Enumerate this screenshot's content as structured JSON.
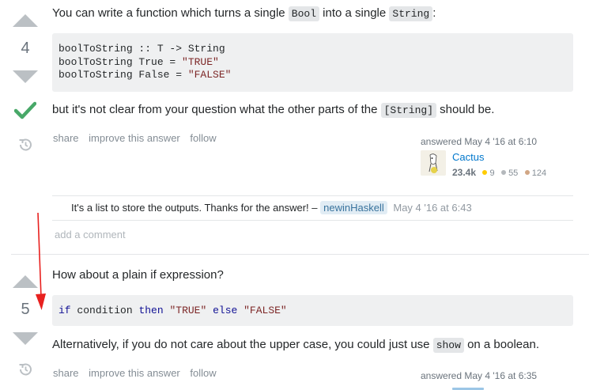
{
  "answer1": {
    "votes": "4",
    "accepted": true,
    "intro": {
      "before": "You can write a function which turns a single ",
      "code1": "Bool",
      "mid": " into a single ",
      "code2": "String",
      "after": ":"
    },
    "code_lines": [
      {
        "plain": "boolToString :: T -> String",
        "str": ""
      },
      {
        "plain": "boolToString True = ",
        "str": "\"TRUE\""
      },
      {
        "plain": "boolToString False = ",
        "str": "\"FALSE\""
      }
    ],
    "followup": {
      "before": "but it's not clear from your question what the other parts of the ",
      "code": "[String]",
      "after": " should be."
    },
    "menu": {
      "share": "share",
      "improve": "improve this answer",
      "follow": "follow"
    },
    "signature": {
      "action": "answered May 4 '16 at 6:10",
      "user": "Cactus",
      "rep": "23.4k",
      "gold": "9",
      "silver": "55",
      "bronze": "124"
    },
    "comment": {
      "text": "It's a list to store the outputs. Thanks for the answer! –",
      "user": "newinHaskell",
      "date": "May 4 '16 at 6:43"
    },
    "add_comment": "add a comment"
  },
  "answer2": {
    "votes": "5",
    "intro": "How about a plain if expression?",
    "code": {
      "kw1": "if",
      "t1": " condition ",
      "kw2": "then",
      "s1": "\"TRUE\"",
      "kw3": "else",
      "s2": "\"FALSE\""
    },
    "alt": {
      "before": "Alternatively, if you do not care about the upper case, you could just use ",
      "code": "show",
      "after": " on a boolean."
    },
    "menu": {
      "share": "share",
      "improve": "improve this answer",
      "follow": "follow"
    },
    "signature": {
      "action": "answered May 4 '16 at 6:35"
    }
  },
  "colors": {
    "accent_link": "#0077cc",
    "accepted_check": "#48a868",
    "annotation_arrow": "#e8211f",
    "badge_gold": "#ffcc01",
    "badge_silver": "#b4b8bc",
    "badge_bronze": "#d1a684"
  },
  "icons": [
    "upvote-icon",
    "downvote-icon",
    "accepted-check-icon",
    "history-icon",
    "annotation-arrow-icon"
  ]
}
